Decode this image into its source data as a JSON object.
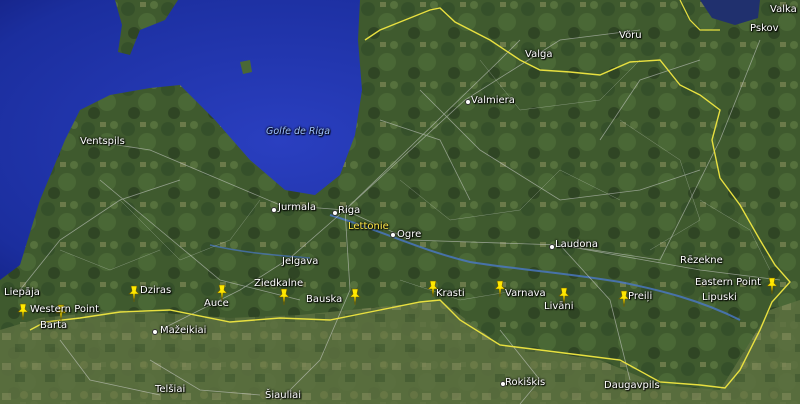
{
  "colors": {
    "sea": "#1b2e9e",
    "sea_deep": "#0b1060",
    "land": "#3f5a2e",
    "border": "#e8e040",
    "roads": "#d8d8d8",
    "rivers": "#4a78c8"
  },
  "water_labels": {
    "gulf": "Golfe de Riga"
  },
  "country_label": "Lettonie",
  "places": {
    "valka": "Valka",
    "voru": "Võru",
    "pskov": "Pskov",
    "valga": "Valga",
    "valmiera": "Valmiera",
    "ventspils": "Ventspils",
    "jurmala": "Jurmala",
    "riga": "Riga",
    "ogre": "Ogre",
    "laudona": "Laudona",
    "rezekne": "Rēzekne",
    "jelgava": "Jelgava",
    "liepaja": "Liepāja",
    "mazeikiai": "Mažeikiai",
    "telsiai": "Telšiai",
    "siauliai": "Šiauliai",
    "rokiskis": "Rokiškis",
    "daugavpils": "Daugavpils"
  },
  "pins": {
    "western_point": "Western Point",
    "barta": "Barta",
    "dziras": "Dziras",
    "auce": "Auce",
    "ziedkalne": "Ziedkalne",
    "bauska": "Bauska",
    "krasti": "Krasti",
    "varnava": "Varnava",
    "livani": "Livāni",
    "preili": "Preiļi",
    "eastern_point": "Eastern Point",
    "lipuski": "Lipuski"
  }
}
